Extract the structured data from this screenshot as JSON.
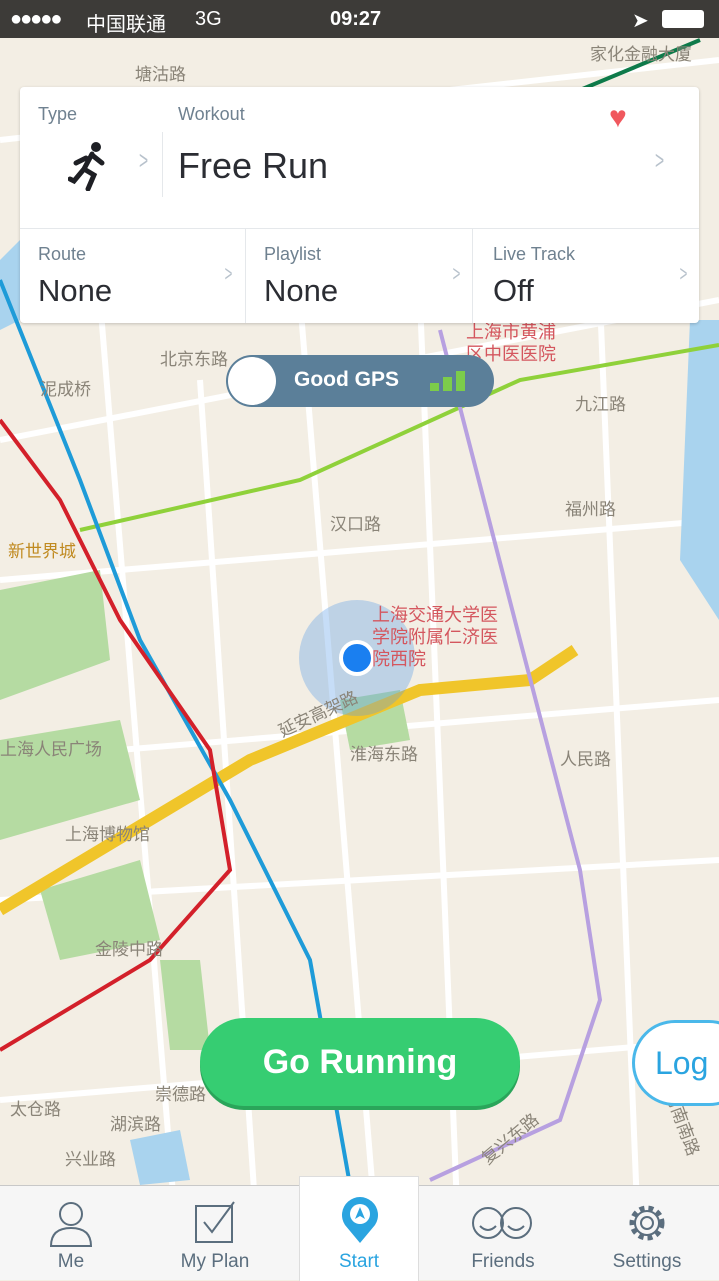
{
  "status_bar": {
    "signal": "●●●●●",
    "carrier": "中国联通",
    "network": "3G",
    "time": "09:27"
  },
  "card": {
    "type_label": "Type",
    "type_icon": "running-person-icon",
    "workout_label": "Workout",
    "workout_value": "Free Run",
    "route_label": "Route",
    "route_value": "None",
    "playlist_label": "Playlist",
    "playlist_value": "None",
    "livetrack_label": "Live Track",
    "livetrack_value": "Off"
  },
  "gps": {
    "label": "Good GPS",
    "signal_bars": 3,
    "signal_max": 3
  },
  "map_labels": [
    "塘沽路",
    "家化金融大厦",
    "上海市黄浦区中医医院",
    "北京东路",
    "泥成桥",
    "九江路",
    "汉口路",
    "福州路",
    "新世界城",
    "上海交通大学医学院附属仁济医院西院",
    "延安高架路",
    "人民路",
    "上海人民广场",
    "上海博物馆",
    "金陵中路",
    "淮海东路",
    "复兴东路",
    "河南南路",
    "湖滨路",
    "兴业路",
    "太仓路",
    "崇德路"
  ],
  "actions": {
    "go_running": "Go Running",
    "log": "Log"
  },
  "tabs": [
    {
      "label": "Me",
      "icon": "person-icon"
    },
    {
      "label": "My Plan",
      "icon": "checkbox-icon"
    },
    {
      "label": "Start",
      "icon": "location-pin-icon"
    },
    {
      "label": "Friends",
      "icon": "smiley-faces-icon"
    },
    {
      "label": "Settings",
      "icon": "gear-icon"
    }
  ],
  "colors": {
    "accent": "#2aa4e0",
    "go_green": "#36cd72",
    "heart": "#f0585e",
    "gps_pill": "#5b7f99"
  }
}
